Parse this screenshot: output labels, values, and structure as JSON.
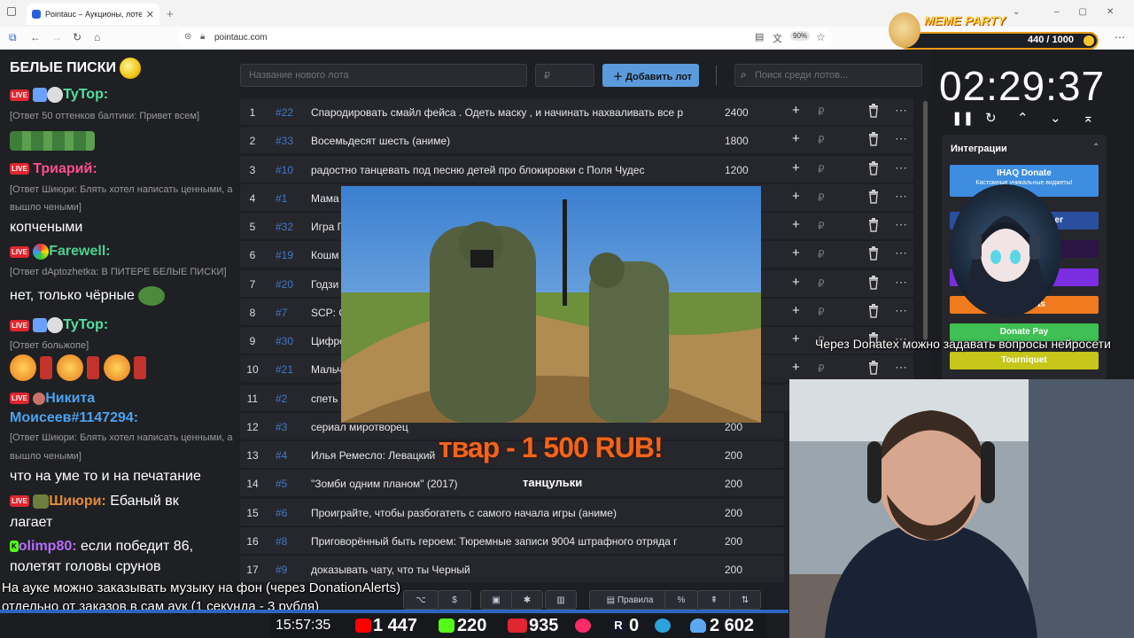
{
  "browser": {
    "tab_title": "Pointauc – Аукционы, лотереи",
    "url": "pointauc.com",
    "zoom": "90%"
  },
  "chat": {
    "messages": [
      {
        "type": "text",
        "text": "БЕЛЫЕ ПИСКИ"
      },
      {
        "type": "user",
        "badge": "LIVE",
        "name": "TyTop:",
        "color": "#53e0a1"
      },
      {
        "type": "sub",
        "text": "[Ответ 50 оттенков балтики: Привет всем]"
      },
      {
        "type": "user",
        "badge": "LIVE",
        "name": "Триарий:",
        "color": "#ff4f8b"
      },
      {
        "type": "sub",
        "text": "[Ответ Шиюри: Блять хотел написать ценными, а"
      },
      {
        "type": "sub",
        "text": "вышло чеными]"
      },
      {
        "type": "text",
        "text": "копчеными"
      },
      {
        "type": "user",
        "badge": "LIVE",
        "name": "Farewell:",
        "color": "#4ad28f"
      },
      {
        "type": "sub",
        "text": "[Ответ dAptozhetka: В ПИТЕРЕ БЕЛЫЕ ПИСКИ]"
      },
      {
        "type": "text",
        "text": "нет, только чёрные"
      },
      {
        "type": "user",
        "badge": "LIVE",
        "name": "TyTop:",
        "color": "#53e0a1"
      },
      {
        "type": "sub",
        "text": "[Ответ больжопе]"
      },
      {
        "type": "user",
        "badge": "LIVE",
        "name": "Никита",
        "color": "#4ba3ef"
      },
      {
        "type": "text2",
        "text": "Моисеев#1147294:",
        "color": "#4ba3ef"
      },
      {
        "type": "sub",
        "text": "[Ответ Шиюри: Блять хотел написать ценными, а"
      },
      {
        "type": "sub",
        "text": "вышло чеными]"
      },
      {
        "type": "text",
        "text": "что на уме то и на печатание"
      },
      {
        "type": "user",
        "badge": "LIVE",
        "name": "Шиюри:",
        "color": "#e28c3a",
        "after": "Ебаный вк"
      },
      {
        "type": "text",
        "text": "лагает"
      },
      {
        "type": "user",
        "badge": "K",
        "name": "olimp80:",
        "color": "#b56dff",
        "after": "если победит 86,"
      },
      {
        "type": "text",
        "text": "полетят головы срунов"
      }
    ]
  },
  "app": {
    "new_lot_placeholder": "Название нового лота",
    "currency_placeholder": "₽",
    "add_label": "Добавить лот",
    "search_placeholder": "Поиск среди лотов...",
    "lots": [
      {
        "n": "1",
        "id": "#22",
        "name": "Спародировать смайл фейса . Одеть маску , и начинать нахваливать все р",
        "amount": "2400"
      },
      {
        "n": "2",
        "id": "#33",
        "name": "Восемьдесят шесть (аниме)",
        "amount": "1800"
      },
      {
        "n": "3",
        "id": "#10",
        "name": "радостно танцевать под песню детей про блокировки с Поля Чудес",
        "amount": "1200"
      },
      {
        "n": "4",
        "id": "#1",
        "name": "Мама",
        "amount": ""
      },
      {
        "n": "5",
        "id": "#32",
        "name": "Игра Г",
        "amount": ""
      },
      {
        "n": "6",
        "id": "#19",
        "name": "Кошм",
        "amount": ""
      },
      {
        "n": "7",
        "id": "#20",
        "name": "Годзи",
        "amount": ""
      },
      {
        "n": "8",
        "id": "#7",
        "name": "SCP: С",
        "amount": ""
      },
      {
        "n": "9",
        "id": "#30",
        "name": "Цифро",
        "amount": ""
      },
      {
        "n": "10",
        "id": "#21",
        "name": "Мальч",
        "amount": ""
      },
      {
        "n": "11",
        "id": "#2",
        "name": "спеть",
        "amount": ""
      },
      {
        "n": "12",
        "id": "#3",
        "name": "сериал миротворец",
        "amount": "200"
      },
      {
        "n": "13",
        "id": "#4",
        "name": "Илья Ремесло: Левацкий",
        "amount": "200"
      },
      {
        "n": "14",
        "id": "#5",
        "name": "\"Зомби одним планом\" (2017)",
        "amount": "200"
      },
      {
        "n": "15",
        "id": "#6",
        "name": "Проиграйте, чтобы разбогатеть с самого начала игры (аниме)",
        "amount": "200"
      },
      {
        "n": "16",
        "id": "#8",
        "name": "Приговорённый быть героем: Тюремные записи 9004 штрафного отряда г",
        "amount": "200"
      },
      {
        "n": "17",
        "id": "#9",
        "name": "доказывать чату, что ты Черный",
        "amount": "200"
      }
    ],
    "toolbar_rules": "Правила"
  },
  "overlay": {
    "donation_text": "твар - 1 500 RUB!",
    "donation_sub": "танцульки"
  },
  "timer": "02:29:37",
  "integrations": {
    "title": "Интеграции",
    "buttons": [
      {
        "label": "IHAQ Donate",
        "color": "#3d8de0"
      },
      {
        "label": "er",
        "color": "#2a4f9f"
      },
      {
        "label": "",
        "color": "#4a2575"
      },
      {
        "label": "",
        "color": "#7b2ee0"
      },
      {
        "label": "Alerts",
        "color": "#f07a1e"
      },
      {
        "label": "Donate Pay",
        "color": "#3fbf54"
      },
      {
        "label": "Tourniquet",
        "color": "#c6c61b"
      }
    ],
    "ihaq_sub": "Кастомные уникальные виджеты!"
  },
  "meme": {
    "title": "MEME PARTY",
    "count": "440 / 1000"
  },
  "tickers": {
    "donatex": "Через Donatex можно задавать вопросы нейросети",
    "music1": "На ауке можно заказывать музыку на фон (через DonationAlerts)",
    "music2": "отдельно от заказов в сам аук (1 секунда - 3 рубля)"
  },
  "stats": {
    "time": "15:57:35",
    "youtube": "1 447",
    "kick": "220",
    "vk": "935",
    "rutube": "0",
    "viewers": "2 602"
  }
}
